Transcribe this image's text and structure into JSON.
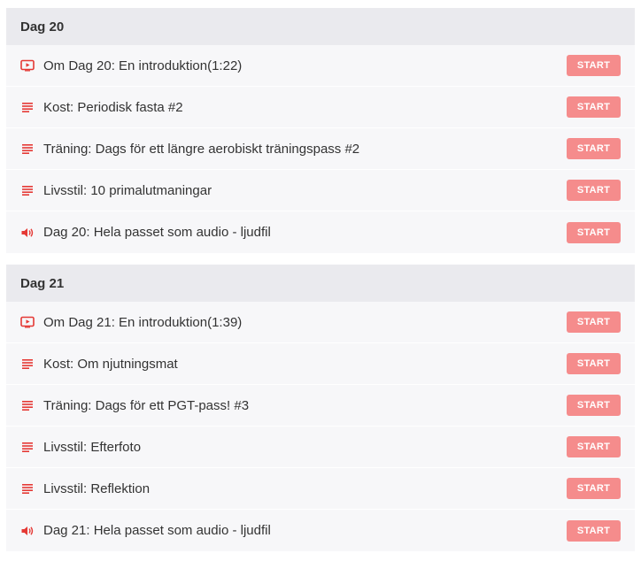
{
  "accent_color": "#e53935",
  "button_color": "#f58c8c",
  "sections": [
    {
      "title": "Dag 20",
      "lessons": [
        {
          "icon": "video-icon",
          "title": "Om Dag 20: En introduktion(1:22)",
          "action": "START"
        },
        {
          "icon": "text-lines-icon",
          "title": "Kost: Periodisk fasta #2",
          "action": "START"
        },
        {
          "icon": "text-lines-icon",
          "title": "Träning: Dags för ett längre aerobiskt träningspass #2",
          "action": "START"
        },
        {
          "icon": "text-lines-icon",
          "title": "Livsstil: 10 primalutmaningar",
          "action": "START"
        },
        {
          "icon": "speaker-icon",
          "title": "Dag 20: Hela passet som audio - ljudfil",
          "action": "START"
        }
      ]
    },
    {
      "title": "Dag 21",
      "lessons": [
        {
          "icon": "video-icon",
          "title": "Om Dag 21: En introduktion(1:39)",
          "action": "START"
        },
        {
          "icon": "text-lines-icon",
          "title": "Kost: Om njutningsmat",
          "action": "START"
        },
        {
          "icon": "text-lines-icon",
          "title": "Träning: Dags för ett PGT-pass! #3",
          "action": "START"
        },
        {
          "icon": "text-lines-icon",
          "title": "Livsstil: Efterfoto",
          "action": "START"
        },
        {
          "icon": "text-lines-icon",
          "title": "Livsstil: Reflektion",
          "action": "START"
        },
        {
          "icon": "speaker-icon",
          "title": "Dag 21: Hela passet som audio - ljudfil",
          "action": "START"
        }
      ]
    }
  ]
}
